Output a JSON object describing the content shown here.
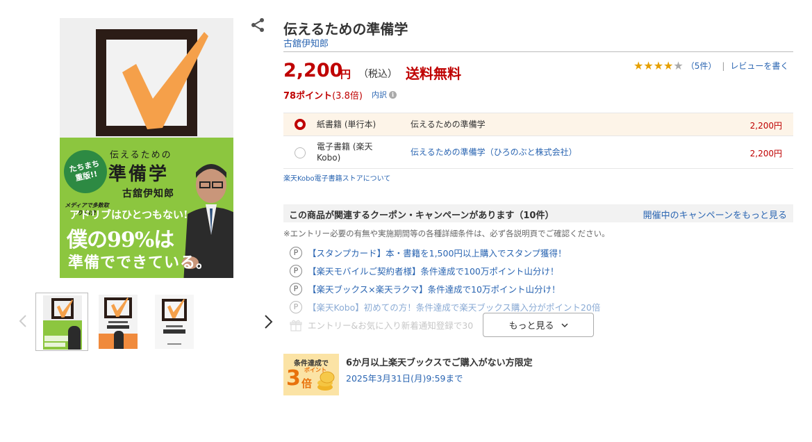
{
  "product": {
    "title": "伝えるための準備学",
    "author": "古舘伊知郎",
    "price": "2,200",
    "yen": "円",
    "tax_label": "（税込）",
    "free_shipping": "送料無料",
    "points_bold": "78ポイント",
    "points_rate": "(3.8倍)",
    "points_breakdown": "内訳",
    "rating": {
      "stars": 4,
      "max_stars": 5,
      "count": "（5件）",
      "separator": "|",
      "write_review": "レビューを書く"
    }
  },
  "cover": {
    "badge": "たちまち重版!!",
    "media": "メディアで多数取り上げ!",
    "small_title": "伝えるための",
    "big_title": "準備学",
    "author": "古舘伊知郎",
    "ad1": "アドリブはひとつもない!",
    "ad2": "僕の99%は",
    "ad3": "準備でできている。",
    "colors": {
      "green": "#8cc63f",
      "check": "#f5a04a",
      "box": "#2b1c16"
    }
  },
  "formats": [
    {
      "type": "紙書籍 (単行本)",
      "name": "伝えるための準備学",
      "price": "2,200円",
      "selected": true
    },
    {
      "type": "電子書籍 (楽天Kobo)",
      "name": "伝えるための準備学（ひろのぶと株式会社）",
      "price": "2,200円",
      "selected": false
    }
  ],
  "kobo_link": "楽天Kobo電子書籍ストアについて",
  "coupons": {
    "title": "この商品が関連するクーポン・キャンペーンがあります（10件）",
    "more_link": "開催中のキャンペーンをもっと見る",
    "note": "※エントリー必要の有無や実施期間等の各種詳細条件は、必ず各説明頁でご確認ください。",
    "p_icon": "P",
    "items": [
      "【スタンプカード】本・書籍を1,500円以上購入でスタンプ獲得！",
      "【楽天モバイルご契約者様】条件達成で100万ポイント山分け！",
      "【楽天ブックス×楽天ラクマ】条件達成で10万ポイント山分け！",
      "【楽天Kobo】初めての方！条件達成で楽天ブックス購入分がポイント20倍",
      "エントリー&お気に入り新着通知登録で30"
    ],
    "more_button": "もっと見る"
  },
  "promo": {
    "badge_line1": "条件達成で",
    "badge_points": "ポイント",
    "badge_big": "3",
    "badge_bai": "倍",
    "headline": "6か月以上楽天ブックスでご購入がない方限定",
    "deadline": "2025年3月31日(月)9:59まで"
  },
  "colors": {
    "price_red": "#bf0000",
    "link_blue": "#2a65b2",
    "star_gold": "#e6a000",
    "selected_row_bg": "#fdf4e8"
  },
  "icons": [
    "share-icon",
    "chevron-left-icon",
    "chevron-right-icon",
    "info-icon",
    "star-icon",
    "point-circle-icon",
    "gift-icon",
    "chevron-down-icon"
  ]
}
